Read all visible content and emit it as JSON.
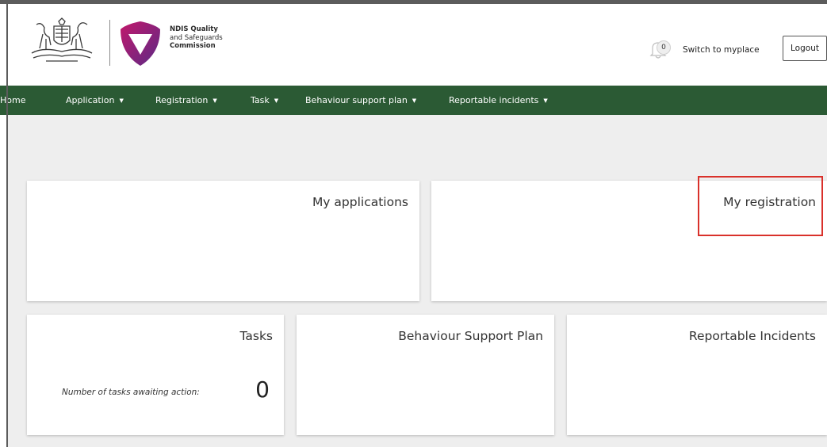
{
  "header": {
    "brand_line1": "NDIS Quality",
    "brand_line2": "and Safeguards",
    "brand_line3": "Commission",
    "notification_count": "0",
    "switch_link": "Switch to myplace",
    "logout_label": "Logout"
  },
  "nav": {
    "items": [
      {
        "label": "Home",
        "dropdown": false
      },
      {
        "label": "Application",
        "dropdown": true
      },
      {
        "label": "Registration",
        "dropdown": true
      },
      {
        "label": "Task",
        "dropdown": true
      },
      {
        "label": "Behaviour support plan",
        "dropdown": true
      },
      {
        "label": "Reportable incidents",
        "dropdown": true
      }
    ],
    "caret": "▼"
  },
  "cards": {
    "my_applications": {
      "title": "My applications"
    },
    "my_registration": {
      "title": "My registration",
      "highlighted": true
    },
    "tasks": {
      "title": "Tasks",
      "caption": "Number of tasks awaiting action:",
      "count": "0"
    },
    "behaviour_support_plan": {
      "title": "Behaviour Support Plan"
    },
    "reportable_incidents": {
      "title": "Reportable Incidents"
    }
  },
  "colors": {
    "nav_bg": "#2b5a34",
    "content_bg": "#eeeeee",
    "highlight": "#d9312b",
    "brand_magenta": "#c2186b",
    "brand_purple": "#5b2a86"
  },
  "icons": {
    "coat_of_arms": "coat-of-arms-icon",
    "ndis_shield": "ndis-shield-icon",
    "bell": "bell-icon",
    "caret": "caret-down-icon"
  }
}
